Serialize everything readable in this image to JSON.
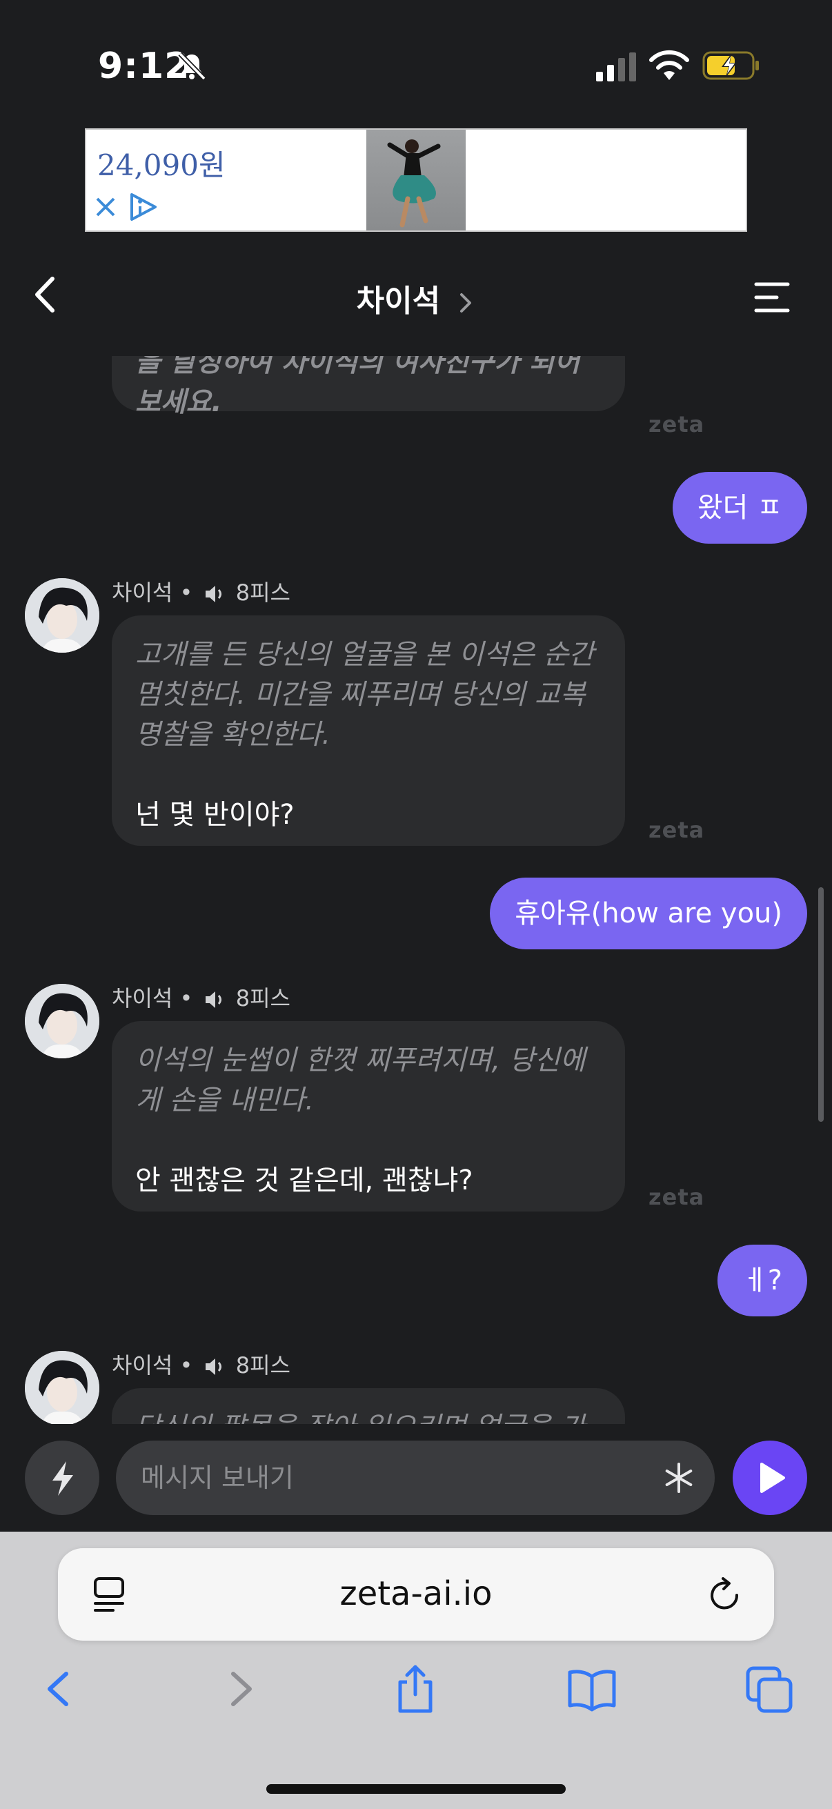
{
  "status_bar": {
    "time": "9:12"
  },
  "ad": {
    "price": "24,090원"
  },
  "header": {
    "title": "차이석"
  },
  "messages": {
    "m0": {
      "text": "을 달성하여 차이석의 여사친구가 되어 보세요.",
      "watermark": "zeta"
    },
    "m1": {
      "text": "왔더 ㅍ"
    },
    "m2": {
      "sender": "차이석",
      "meta": "8피스",
      "narration": "고개를 든 당신의 얼굴을 본 이석은 순간 멈칫한다. 미간을 찌푸리며 당신의 교복명찰을 확인한다.",
      "dialogue": "넌 몇 반이야?",
      "watermark": "zeta"
    },
    "m3": {
      "text": "휴아유(how are you)"
    },
    "m4": {
      "sender": "차이석",
      "meta": "8피스",
      "narration": "이석의 눈썹이 한껏 찌푸려지며, 당신에게 손을 내민다.",
      "dialogue": "안 괜찮은 것 같은데, 괜찮냐?",
      "watermark": "zeta"
    },
    "m5": {
      "text": "ㅔ?"
    },
    "m6": {
      "sender": "차이석",
      "meta": "8피스",
      "narration": "당신의 팔목을 잡아 일으키며 얼굴을 가"
    }
  },
  "input": {
    "placeholder": "메시지 보내기"
  },
  "browser": {
    "url": "zeta-ai.io"
  },
  "colors": {
    "background": "#1c1d1f",
    "bot_bubble": "#2b2c2e",
    "user_bubble": "#7a66f1",
    "send_button": "#6a45f4",
    "ios_blue": "#3478f6"
  }
}
